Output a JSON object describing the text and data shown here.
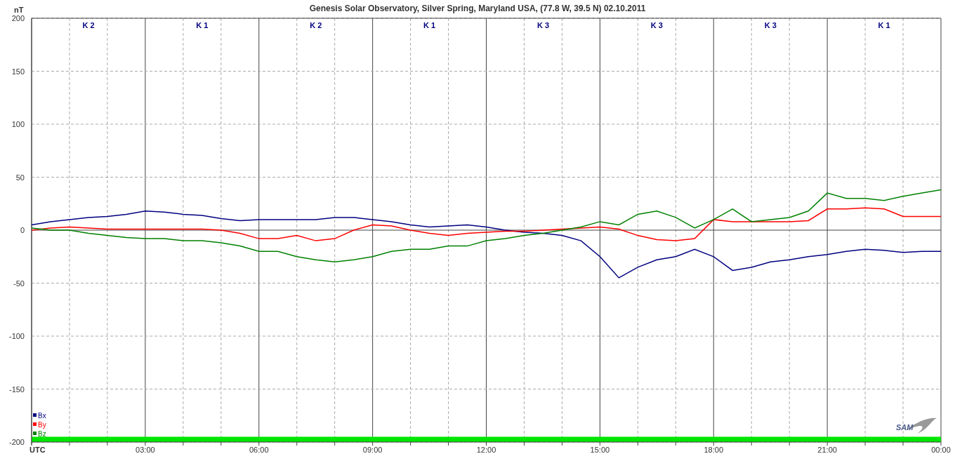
{
  "chart_data": {
    "type": "line",
    "title": "Genesis Solar Observatory, Silver Spring, Maryland USA, (77.8 W, 39.5 N)  02.10.2011",
    "xlabel": "UTC",
    "ylabel": "nT",
    "x": [
      0,
      0.5,
      1,
      1.5,
      2,
      2.5,
      3,
      3.5,
      4,
      4.5,
      5,
      5.5,
      6,
      6.5,
      7,
      7.5,
      8,
      8.5,
      9,
      9.5,
      10,
      10.5,
      11,
      11.5,
      12,
      12.5,
      13,
      13.5,
      14,
      14.5,
      15,
      15.5,
      16,
      16.5,
      17,
      17.5,
      18,
      18.5,
      19,
      19.5,
      20,
      20.5,
      21,
      21.5,
      22,
      22.5,
      23,
      23.5,
      24
    ],
    "series": [
      {
        "name": "Bx",
        "color": "#000080",
        "values": [
          5,
          8,
          10,
          12,
          13,
          15,
          18,
          17,
          15,
          14,
          11,
          9,
          10,
          10,
          10,
          10,
          12,
          12,
          10,
          8,
          5,
          3,
          4,
          5,
          3,
          0,
          -2,
          -3,
          -5,
          -10,
          -25,
          -45,
          -35,
          -28,
          -25,
          -18,
          -25,
          -38,
          -35,
          -30,
          -28,
          -25,
          -23,
          -20,
          -18,
          -19,
          -21,
          -20,
          -20
        ]
      },
      {
        "name": "By",
        "color": "#ff0000",
        "values": [
          0,
          2,
          3,
          2,
          1,
          1,
          1,
          1,
          1,
          1,
          0,
          -3,
          -8,
          -8,
          -5,
          -10,
          -8,
          0,
          5,
          4,
          0,
          -3,
          -5,
          -3,
          -2,
          -1,
          -1,
          0,
          1,
          2,
          3,
          1,
          -5,
          -9,
          -10,
          -8,
          10,
          8,
          8,
          8,
          8,
          9,
          20,
          20,
          21,
          20,
          13,
          13,
          13
        ]
      },
      {
        "name": "Bz",
        "color": "#008000",
        "values": [
          2,
          0,
          0,
          -3,
          -5,
          -7,
          -8,
          -8,
          -10,
          -10,
          -12,
          -15,
          -20,
          -20,
          -25,
          -28,
          -30,
          -28,
          -25,
          -20,
          -18,
          -18,
          -15,
          -15,
          -10,
          -8,
          -5,
          -3,
          0,
          3,
          8,
          5,
          15,
          18,
          12,
          2,
          10,
          20,
          8,
          10,
          12,
          18,
          35,
          30,
          30,
          28,
          32,
          35,
          38
        ]
      }
    ],
    "grid": true,
    "bands": [
      {
        "axis": "y",
        "from": -200,
        "to": -195,
        "color": "#00e600"
      }
    ],
    "legend": true,
    "xlim": [
      0,
      24
    ],
    "ylim": [
      -200,
      200
    ],
    "xticks": [
      {
        "value": 3,
        "label": "03:00"
      },
      {
        "value": 6,
        "label": "06:00"
      },
      {
        "value": 9,
        "label": "09:00"
      },
      {
        "value": 12,
        "label": "12:00"
      },
      {
        "value": 15,
        "label": "15:00"
      },
      {
        "value": 18,
        "label": "18:00"
      },
      {
        "value": 21,
        "label": "21:00"
      },
      {
        "value": 24,
        "label": "00:00"
      }
    ],
    "yticks": [
      -200,
      -150,
      -100,
      -50,
      0,
      50,
      100,
      150,
      200
    ]
  },
  "k_indices": [
    {
      "label": "K 2"
    },
    {
      "label": "K 1"
    },
    {
      "label": "K 2"
    },
    {
      "label": "K 1"
    },
    {
      "label": "K 3"
    },
    {
      "label": "K 3"
    },
    {
      "label": "K 3"
    },
    {
      "label": "K 1"
    }
  ],
  "logo": {
    "text": "SAM"
  }
}
